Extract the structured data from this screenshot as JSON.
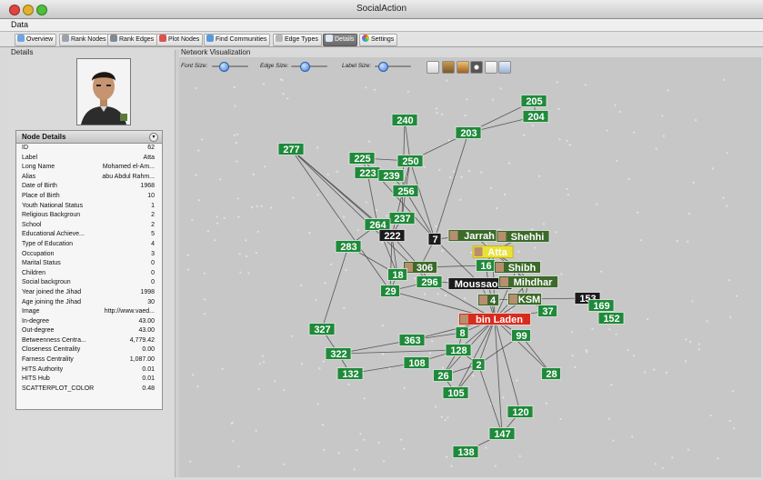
{
  "window": {
    "title": "SocialAction"
  },
  "menu": {
    "data": "Data"
  },
  "tabs": [
    {
      "label": "Overview",
      "icon": "overview-icon",
      "active": false
    },
    {
      "label": "Rank Nodes",
      "icon": "rank-nodes-icon",
      "active": false
    },
    {
      "label": "Rank Edges",
      "icon": "rank-edges-icon",
      "active": false
    },
    {
      "label": "Plot Nodes",
      "icon": "plot-nodes-icon",
      "active": false
    },
    {
      "label": "Find Communities",
      "icon": "find-communities-icon",
      "active": false
    },
    {
      "label": "Edge Types",
      "icon": "edge-types-icon",
      "active": false
    },
    {
      "label": "Details",
      "icon": "details-icon",
      "active": true
    },
    {
      "label": "Settings",
      "icon": "settings-icon",
      "active": false
    }
  ],
  "details_pane": {
    "title": "Details"
  },
  "node_details": {
    "title": "Node Details",
    "rows": [
      {
        "key": "ID",
        "value": "62"
      },
      {
        "key": "Label",
        "value": "Atta"
      },
      {
        "key": "Long Name",
        "value": "Mohamed el-Am..."
      },
      {
        "key": "Alias",
        "value": "abu Abdul Rahm..."
      },
      {
        "key": "Date of Birth",
        "value": "1968"
      },
      {
        "key": "Place of Birth",
        "value": "10"
      },
      {
        "key": "Youth National Status",
        "value": "1"
      },
      {
        "key": "Religious Backgroun",
        "value": "2"
      },
      {
        "key": "School",
        "value": "2"
      },
      {
        "key": "Educational Achieve...",
        "value": "5"
      },
      {
        "key": "Type of Education",
        "value": "4"
      },
      {
        "key": "Occupation",
        "value": "3"
      },
      {
        "key": "Marital Status",
        "value": "0"
      },
      {
        "key": "Children",
        "value": "0"
      },
      {
        "key": "Social backgroun",
        "value": "0"
      },
      {
        "key": "Year joined the Jihad",
        "value": "1998"
      },
      {
        "key": "Age joining the Jihad",
        "value": "30"
      },
      {
        "key": "Image",
        "value": "http://www.vaed..."
      },
      {
        "key": "In-degree",
        "value": "43.00"
      },
      {
        "key": "Out-degree",
        "value": "43.00"
      },
      {
        "key": "Betweenness Centra...",
        "value": "4,779.42"
      },
      {
        "key": "Closeness Centrality",
        "value": "0.00"
      },
      {
        "key": "Farness Centrality",
        "value": "1,087.00"
      },
      {
        "key": "HITS Authority",
        "value": "0.01"
      },
      {
        "key": "HITS Hub",
        "value": "0.01"
      },
      {
        "key": "SCATTERPLOT_COLOR",
        "value": "0.48"
      }
    ]
  },
  "viz": {
    "title": "Network Visualization",
    "font_size_label": "Font Size:",
    "edge_size_label": "Edge Size:",
    "label_size_label": "Label Size:",
    "font_size_value": 0.3,
    "edge_size_value": 0.35,
    "label_size_value": 0.2
  },
  "colors": {
    "node_green": "#1f8a3a",
    "node_dark": "#1b1b1b",
    "node_selected": "#d92b1c",
    "node_highlight": "#e8e23a",
    "edge": "#3a3a3a",
    "active_tab": "#7a7a7a"
  },
  "nodes": [
    {
      "id": "205",
      "label": "205",
      "style": "green"
    },
    {
      "id": "204",
      "label": "204",
      "style": "green"
    },
    {
      "id": "240",
      "label": "240",
      "style": "green"
    },
    {
      "id": "203",
      "label": "203",
      "style": "green"
    },
    {
      "id": "277",
      "label": "277",
      "style": "green"
    },
    {
      "id": "225",
      "label": "225",
      "style": "green"
    },
    {
      "id": "250",
      "label": "250",
      "style": "green"
    },
    {
      "id": "223",
      "label": "223",
      "style": "green"
    },
    {
      "id": "239",
      "label": "239",
      "style": "green"
    },
    {
      "id": "256",
      "label": "256",
      "style": "green"
    },
    {
      "id": "237",
      "label": "237",
      "style": "green"
    },
    {
      "id": "264",
      "label": "264",
      "style": "green"
    },
    {
      "id": "222",
      "label": "222",
      "style": "dark"
    },
    {
      "id": "7",
      "label": "7",
      "style": "dark"
    },
    {
      "id": "jarrah",
      "label": "Jarrah",
      "style": "photo"
    },
    {
      "id": "shehhi",
      "label": "Shehhi",
      "style": "photo"
    },
    {
      "id": "283",
      "label": "283",
      "style": "green"
    },
    {
      "id": "atta",
      "label": "Atta",
      "style": "highlight"
    },
    {
      "id": "306",
      "label": "306",
      "style": "photo"
    },
    {
      "id": "16",
      "label": "16",
      "style": "green"
    },
    {
      "id": "shibh",
      "label": "Shibh",
      "style": "photo"
    },
    {
      "id": "18",
      "label": "18",
      "style": "green"
    },
    {
      "id": "296",
      "label": "296",
      "style": "green"
    },
    {
      "id": "moussaoui",
      "label": "Moussaoui",
      "style": "dark"
    },
    {
      "id": "mihdhar",
      "label": "Mihdhar",
      "style": "photo"
    },
    {
      "id": "29",
      "label": "29",
      "style": "green"
    },
    {
      "id": "4",
      "label": "4",
      "style": "photo"
    },
    {
      "id": "ksm",
      "label": "KSM",
      "style": "photo"
    },
    {
      "id": "153",
      "label": "153",
      "style": "dark"
    },
    {
      "id": "169",
      "label": "169",
      "style": "green"
    },
    {
      "id": "37",
      "label": "37",
      "style": "green"
    },
    {
      "id": "152",
      "label": "152",
      "style": "green"
    },
    {
      "id": "binladen",
      "label": "bin Laden",
      "style": "selected"
    },
    {
      "id": "327",
      "label": "327",
      "style": "green"
    },
    {
      "id": "8",
      "label": "8",
      "style": "green"
    },
    {
      "id": "99",
      "label": "99",
      "style": "green"
    },
    {
      "id": "363",
      "label": "363",
      "style": "green"
    },
    {
      "id": "322",
      "label": "322",
      "style": "green"
    },
    {
      "id": "128",
      "label": "128",
      "style": "green"
    },
    {
      "id": "108",
      "label": "108",
      "style": "green"
    },
    {
      "id": "2",
      "label": "2",
      "style": "green"
    },
    {
      "id": "132",
      "label": "132",
      "style": "green"
    },
    {
      "id": "26",
      "label": "26",
      "style": "green"
    },
    {
      "id": "28",
      "label": "28",
      "style": "green"
    },
    {
      "id": "105",
      "label": "105",
      "style": "green"
    },
    {
      "id": "120",
      "label": "120",
      "style": "green"
    },
    {
      "id": "147",
      "label": "147",
      "style": "green"
    },
    {
      "id": "138",
      "label": "138",
      "style": "green"
    }
  ],
  "edges": [
    [
      "277",
      "222"
    ],
    [
      "277",
      "264"
    ],
    [
      "277",
      "29"
    ],
    [
      "277",
      "296"
    ],
    [
      "240",
      "250"
    ],
    [
      "240",
      "237"
    ],
    [
      "203",
      "250"
    ],
    [
      "203",
      "7"
    ],
    [
      "203",
      "205"
    ],
    [
      "203",
      "204"
    ],
    [
      "205",
      "204"
    ],
    [
      "225",
      "250"
    ],
    [
      "225",
      "223"
    ],
    [
      "225",
      "7"
    ],
    [
      "223",
      "239"
    ],
    [
      "223",
      "264"
    ],
    [
      "239",
      "256"
    ],
    [
      "250",
      "256"
    ],
    [
      "250",
      "222"
    ],
    [
      "250",
      "7"
    ],
    [
      "256",
      "237"
    ],
    [
      "256",
      "7"
    ],
    [
      "237",
      "264"
    ],
    [
      "237",
      "222"
    ],
    [
      "264",
      "222"
    ],
    [
      "264",
      "283"
    ],
    [
      "264",
      "18"
    ],
    [
      "222",
      "18"
    ],
    [
      "222",
      "306"
    ],
    [
      "222",
      "29"
    ],
    [
      "7",
      "306"
    ],
    [
      "7",
      "moussaoui"
    ],
    [
      "7",
      "jarrah"
    ],
    [
      "jarrah",
      "shehhi"
    ],
    [
      "jarrah",
      "atta"
    ],
    [
      "shehhi",
      "atta"
    ],
    [
      "atta",
      "16"
    ],
    [
      "atta",
      "shibh"
    ],
    [
      "atta",
      "mihdhar"
    ],
    [
      "atta",
      "binladen"
    ],
    [
      "16",
      "shibh"
    ],
    [
      "16",
      "306"
    ],
    [
      "shibh",
      "mihdhar"
    ],
    [
      "shibh",
      "ksm"
    ],
    [
      "mihdhar",
      "ksm"
    ],
    [
      "ksm",
      "153"
    ],
    [
      "ksm",
      "37"
    ],
    [
      "ksm",
      "binladen"
    ],
    [
      "153",
      "169"
    ],
    [
      "153",
      "152"
    ],
    [
      "169",
      "152"
    ],
    [
      "37",
      "binladen"
    ],
    [
      "306",
      "296"
    ],
    [
      "306",
      "18"
    ],
    [
      "296",
      "moussaoui"
    ],
    [
      "296",
      "29"
    ],
    [
      "296",
      "binladen"
    ],
    [
      "moussaoui",
      "4"
    ],
    [
      "4",
      "binladen"
    ],
    [
      "4",
      "ksm"
    ],
    [
      "18",
      "29"
    ],
    [
      "29",
      "binladen"
    ],
    [
      "binladen",
      "8"
    ],
    [
      "binladen",
      "99"
    ],
    [
      "binladen",
      "128"
    ],
    [
      "binladen",
      "2"
    ],
    [
      "binladen",
      "363"
    ],
    [
      "binladen",
      "26"
    ],
    [
      "binladen",
      "28"
    ],
    [
      "binladen",
      "120"
    ],
    [
      "binladen",
      "147"
    ],
    [
      "binladen",
      "105"
    ],
    [
      "283",
      "327"
    ],
    [
      "327",
      "322"
    ],
    [
      "322",
      "132"
    ],
    [
      "322",
      "128"
    ],
    [
      "132",
      "108"
    ],
    [
      "363",
      "322"
    ],
    [
      "363",
      "8"
    ],
    [
      "108",
      "128"
    ],
    [
      "8",
      "128"
    ],
    [
      "128",
      "2"
    ],
    [
      "128",
      "26"
    ],
    [
      "2",
      "26"
    ],
    [
      "2",
      "105"
    ],
    [
      "26",
      "105"
    ],
    [
      "2",
      "147"
    ],
    [
      "147",
      "138"
    ],
    [
      "120",
      "147"
    ],
    [
      "99",
      "28"
    ],
    [
      "99",
      "2"
    ],
    [
      "283",
      "18"
    ],
    [
      "16",
      "binladen"
    ],
    [
      "shibh",
      "binladen"
    ],
    [
      "mihdhar",
      "binladen"
    ]
  ]
}
